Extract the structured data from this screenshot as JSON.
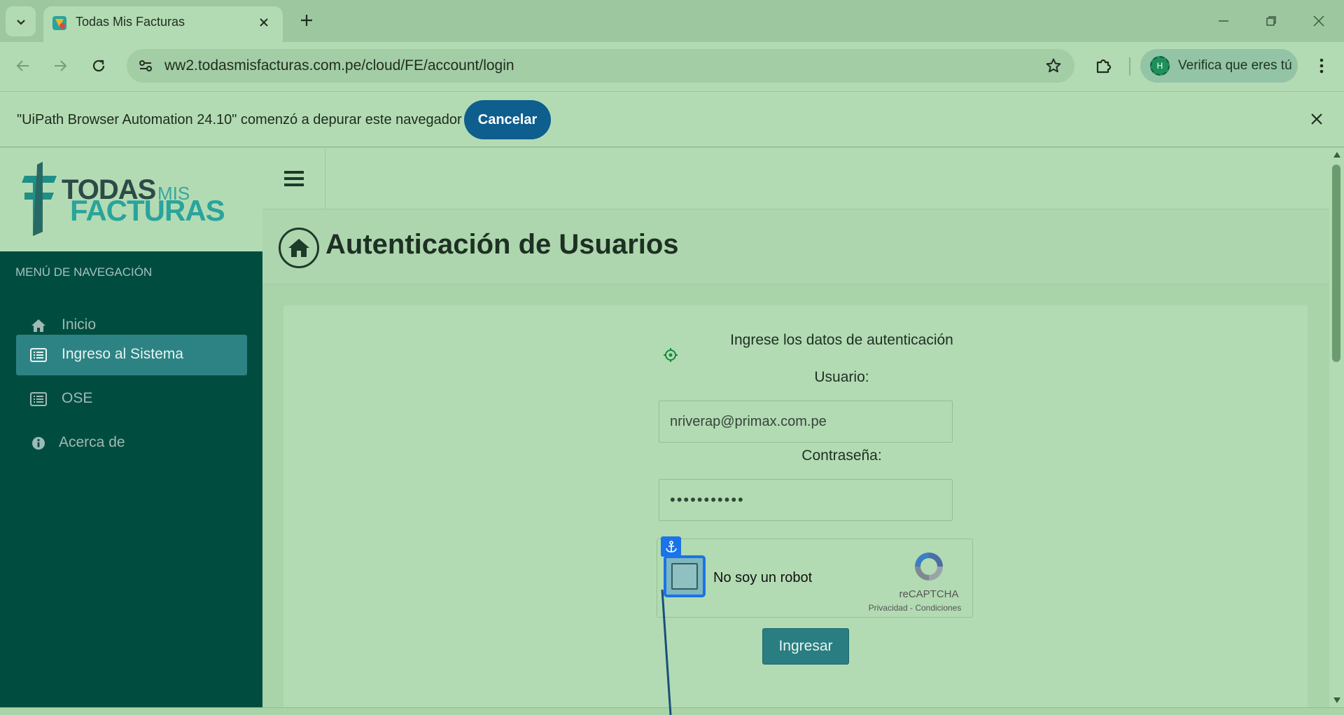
{
  "browser": {
    "tab_title": "Todas Mis Facturas",
    "url": "ww2.todasmisfacturas.com.pe/cloud/FE/account/login",
    "profile_initial": "H",
    "profile_label": "Verifica que eres tú"
  },
  "infobar": {
    "message": "\"UiPath Browser Automation 24.10\" comenzó a depurar este navegador",
    "cancel_label": "Cancelar"
  },
  "logo": {
    "todas": "TODAS",
    "mis": "MIS",
    "facturas": "FACTURAS"
  },
  "sidebar": {
    "heading": "MENÚ DE NAVEGACIÓN",
    "items": [
      {
        "label": "Inicio",
        "icon": "home-icon"
      },
      {
        "label": "Ingreso al Sistema",
        "icon": "list-icon",
        "active": true
      },
      {
        "label": "OSE",
        "icon": "list-icon"
      },
      {
        "label": "Acerca de",
        "icon": "info-icon"
      }
    ]
  },
  "page": {
    "title": "Autenticación de Usuarios"
  },
  "login": {
    "intro": "Ingrese los datos de autenticación",
    "user_label": "Usuario:",
    "user_value": "nriverap@primax.com.pe",
    "password_label": "Contraseña:",
    "password_value": "•••••••••••",
    "captcha_label": "No soy un robot",
    "captcha_brand": "reCAPTCHA",
    "captcha_links": "Privacidad - Condiciones",
    "submit_label": "Ingresar"
  },
  "colors": {
    "sidebar_bg": "#004d40",
    "active_item": "#2d8384",
    "accent_button": "#2a7d80",
    "infobar_button": "#0e5e8e",
    "anchor_blue": "#1a73e8"
  }
}
